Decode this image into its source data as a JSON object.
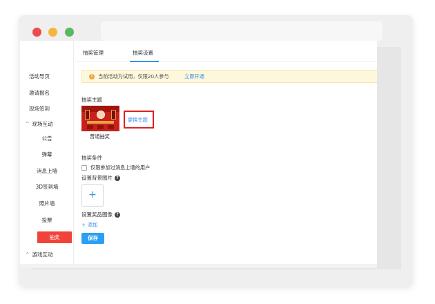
{
  "sidebar": {
    "items": [
      {
        "label": "活动导页",
        "chev": ""
      },
      {
        "label": "邀请报名",
        "chev": ""
      },
      {
        "label": "现场签到",
        "chev": ""
      },
      {
        "label": "现场互动",
        "chev": "^"
      },
      {
        "label": "公告",
        "chev": ""
      },
      {
        "label": "弹幕",
        "chev": ""
      },
      {
        "label": "消息上墙",
        "chev": ""
      },
      {
        "label": "3D签到墙",
        "chev": ""
      },
      {
        "label": "照片墙",
        "chev": ""
      },
      {
        "label": "投票",
        "chev": ""
      },
      {
        "label": "抽奖",
        "chev": ""
      },
      {
        "label": "游戏互动",
        "chev": "^"
      }
    ],
    "active_index": 10
  },
  "tabs": [
    {
      "label": "抽奖管理"
    },
    {
      "label": "抽奖设置"
    }
  ],
  "active_tab": 1,
  "notice": {
    "icon": "!",
    "text": "当前活动为试用，仅限20人参与",
    "link": "立即开通"
  },
  "form": {
    "theme_label": "抽奖主题",
    "theme_name": "普通抽奖",
    "change_theme": "更换主题",
    "condition_label": "抽奖条件",
    "condition_checkbox": "仅限参加过消息上墙的用户",
    "bg_label": "设置背景图片",
    "upload_plus": "+",
    "prize_label": "设置奖品图像",
    "help_icon": "?",
    "add_link": "+ 添加",
    "save": "保存"
  },
  "colors": {
    "accent": "#3a8ee6",
    "active_nav": "#f0433a",
    "highlight_box": "#e01f1f",
    "save": "#2a9ff6"
  }
}
